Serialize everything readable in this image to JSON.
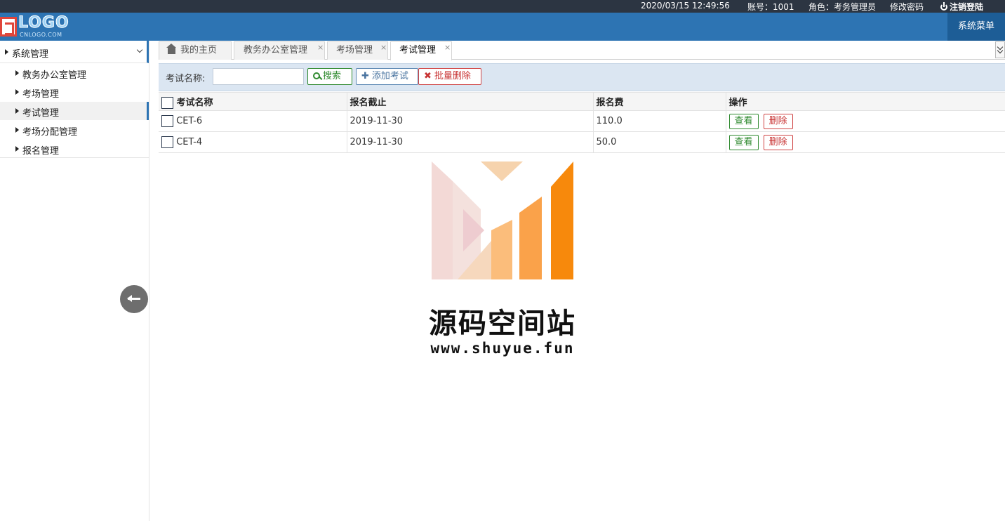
{
  "topbar": {
    "datetime": "2020/03/15 12:49:56",
    "account": "账号：1001",
    "role": "角色：考务管理员",
    "change_password": "修改密码",
    "logout": "注销登陆"
  },
  "header": {
    "logo_text": "LOGO",
    "logo_sub": "CNLOGO.COM",
    "system_menu": "系统菜单"
  },
  "sidebar": {
    "group": "系统管理",
    "items": [
      {
        "label": "教务办公室管理"
      },
      {
        "label": "考场管理"
      },
      {
        "label": "考试管理"
      },
      {
        "label": "考场分配管理"
      },
      {
        "label": "报名管理"
      }
    ],
    "active_index": 2
  },
  "tabs": [
    {
      "label": "我的主页"
    },
    {
      "label": "教务办公室管理",
      "close": "×"
    },
    {
      "label": "考场管理",
      "close": "×"
    },
    {
      "label": "考试管理",
      "close": "×"
    }
  ],
  "toolbar": {
    "search_label": "考试名称:",
    "search_value": "",
    "search_button": "搜索",
    "add_button": "添加考试",
    "batch_delete_button": "批量删除"
  },
  "table": {
    "columns": [
      "考试名称",
      "报名截止",
      "报名费",
      "操作"
    ],
    "rows": [
      {
        "name": "CET-6",
        "deadline": "2019-11-30",
        "fee": "110.0"
      },
      {
        "name": "CET-4",
        "deadline": "2019-11-30",
        "fee": "50.0"
      }
    ],
    "view_label": "查看",
    "delete_label": "删除"
  },
  "watermark": {
    "title": "源码空间站",
    "url": "www.shuyue.fun"
  },
  "colors": {
    "topbar": "#2c3542",
    "header": "#2d74b3",
    "toolbar": "#dbe6f2",
    "success": "#2f8a2f",
    "danger": "#c83333",
    "watermark_orange": "#f7890c"
  }
}
